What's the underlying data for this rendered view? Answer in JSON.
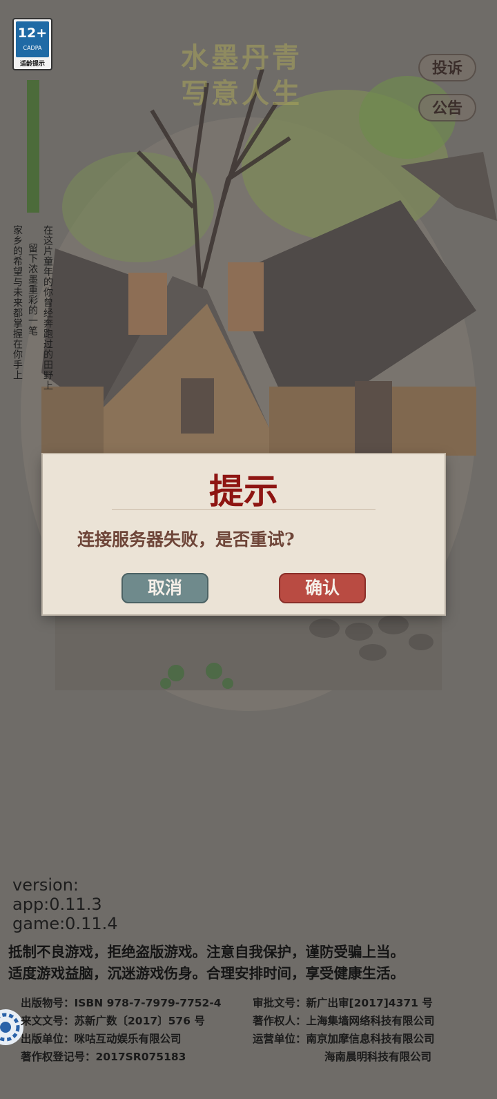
{
  "age_rating": {
    "number": "12+",
    "org": "CADPA",
    "tip": "适龄提示"
  },
  "faded_title": {
    "line1": "水墨丹青",
    "line2": "写意人生"
  },
  "vertical_text": {
    "col1": "在这片童年的你曾经奔跑过的田野上",
    "col2": "留下浓墨重彩的一笔",
    "col3": "家乡的希望与未来都掌握在你手上"
  },
  "side_buttons": {
    "complaint": "投诉",
    "notice": "公告"
  },
  "dialog": {
    "title": "提示",
    "message": "连接服务器失败，是否重试?",
    "cancel": "取消",
    "confirm": "确认"
  },
  "version": {
    "label": "version:",
    "app": "app:0.11.3",
    "game": "game:0.11.4"
  },
  "warning": {
    "line1": "抵制不良游戏，拒绝盗版游戏。注意自我保护，谨防受骗上当。",
    "line2": "适度游戏益脑，沉迷游戏伤身。合理安排时间，享受健康生活。"
  },
  "publish_info": {
    "left": [
      "出版物号：ISBN 978-7-7979-7752-4",
      "来文文号：苏新广数〔2017〕576 号",
      "出版单位：咪咕互动娱乐有限公司",
      "著作权登记号：2017SR075183"
    ],
    "right": [
      "审批文号：新广出审[2017]4371 号",
      "著作权人：上海集墙网络科技有限公司",
      "运营单位：南京加摩信息科技有限公司",
      "海南晨明科技有限公司"
    ]
  },
  "colors": {
    "dialog_title": "#8e1512",
    "cancel_btn": "#6f8a8c",
    "confirm_btn": "#b94b42"
  }
}
